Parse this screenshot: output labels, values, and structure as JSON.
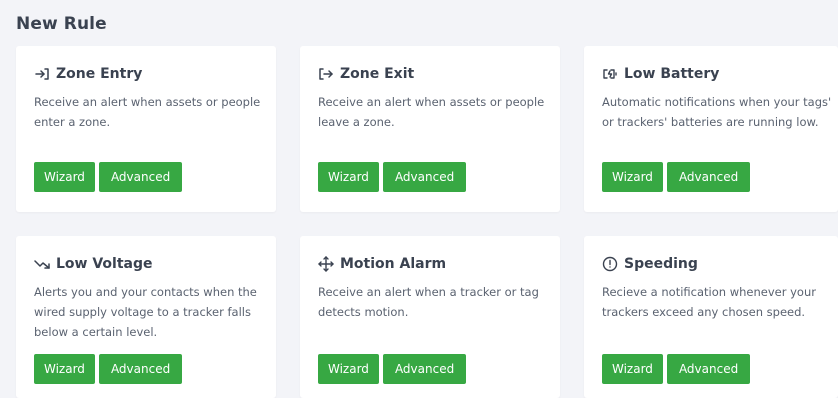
{
  "page": {
    "title": "New Rule"
  },
  "buttons": {
    "wizard": "Wizard",
    "advanced": "Advanced"
  },
  "cards": [
    {
      "title": "Zone Entry",
      "description": "Receive an alert when assets or people enter a zone.",
      "icon": "zone-entry-icon"
    },
    {
      "title": "Zone Exit",
      "description": "Receive an alert when assets or people leave a zone.",
      "icon": "zone-exit-icon"
    },
    {
      "title": "Low Battery",
      "description": "Automatic notifications when your tags' or trackers' batteries are running low.",
      "icon": "battery-icon"
    },
    {
      "title": "Low Voltage",
      "description": "Alerts you and your contacts when the wired supply voltage to a tracker falls below a certain level.",
      "icon": "trend-down-icon"
    },
    {
      "title": "Motion Alarm",
      "description": "Receive an alert when a tracker or tag detects motion.",
      "icon": "move-icon"
    },
    {
      "title": "Speeding",
      "description": "Recieve a notification whenever your trackers exceed any chosen speed.",
      "icon": "alert-circle-icon"
    }
  ],
  "colors": {
    "accent": "#37a843",
    "background": "#f3f4f8",
    "card": "#ffffff"
  }
}
